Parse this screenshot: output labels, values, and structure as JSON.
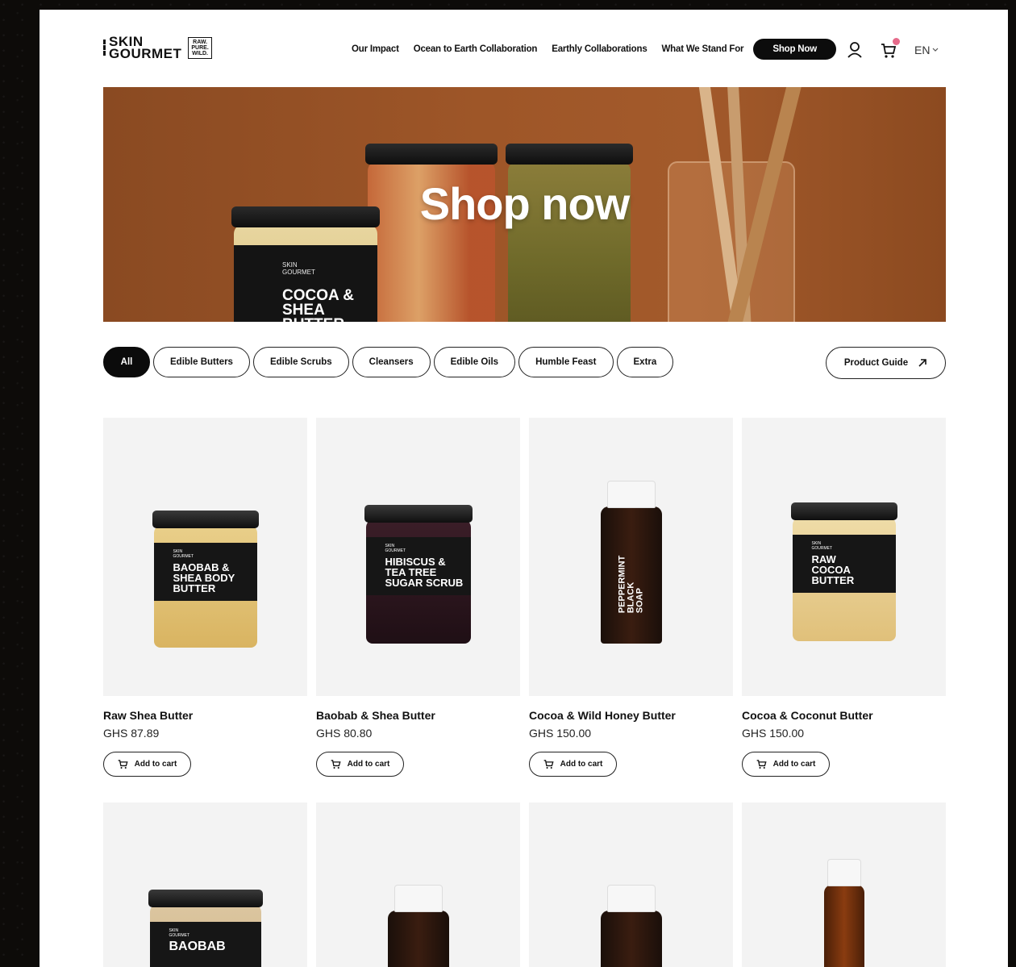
{
  "brand": {
    "logo_main_line1": "SKIN",
    "logo_main_line2": "GOURMET",
    "logo_box": [
      "RAW.",
      "PURE.",
      "WILD."
    ]
  },
  "nav": {
    "items": [
      "Our Impact",
      "Ocean to Earth Collaboration",
      "Earthly Collaborations",
      "What We Stand For"
    ],
    "shop_now": "Shop Now",
    "language": "EN"
  },
  "hero": {
    "title": "Shop now",
    "jar_small": "SKIN\nGOURMET",
    "jar_big": "COCOA &\nSHEA BUTTER"
  },
  "filters": {
    "chips": [
      "All",
      "Edible Butters",
      "Edible Scrubs",
      "Cleansers",
      "Edible Oils",
      "Humble Feast",
      "Extra"
    ],
    "active": "All",
    "product_guide": "Product Guide"
  },
  "products": [
    {
      "name": "Raw Shea Butter",
      "price": "GHS 87.89",
      "add_label": "Add to cart",
      "label_text": "BAOBAB &\nSHEA BODY\nBUTTER"
    },
    {
      "name": "Baobab & Shea Butter",
      "price": "GHS 80.80",
      "add_label": "Add to cart",
      "label_text": "HIBISCUS &\nTEA TREE\nSUGAR SCRUB"
    },
    {
      "name": "Cocoa & Wild Honey Butter",
      "price": "GHS 150.00",
      "add_label": "Add to cart",
      "label_text": "PEPPERMINT\nBLACK\nSOAP"
    },
    {
      "name": "Cocoa & Coconut Butter",
      "price": "GHS 150.00",
      "add_label": "Add to cart",
      "label_text": "RAW\nCOCOA\nBUTTER"
    }
  ],
  "products_row2": [
    {
      "label_text": "BAOBAB"
    },
    {
      "label_text": ""
    },
    {
      "label_text": ""
    },
    {
      "label_text": ""
    }
  ],
  "colors": {
    "background": "#0d0b09",
    "hero": "#9e5628",
    "accent_badge": "#e66a8a"
  },
  "icons": [
    "user-icon",
    "cart-icon",
    "chevron-down-icon",
    "arrow-up-right-icon"
  ]
}
